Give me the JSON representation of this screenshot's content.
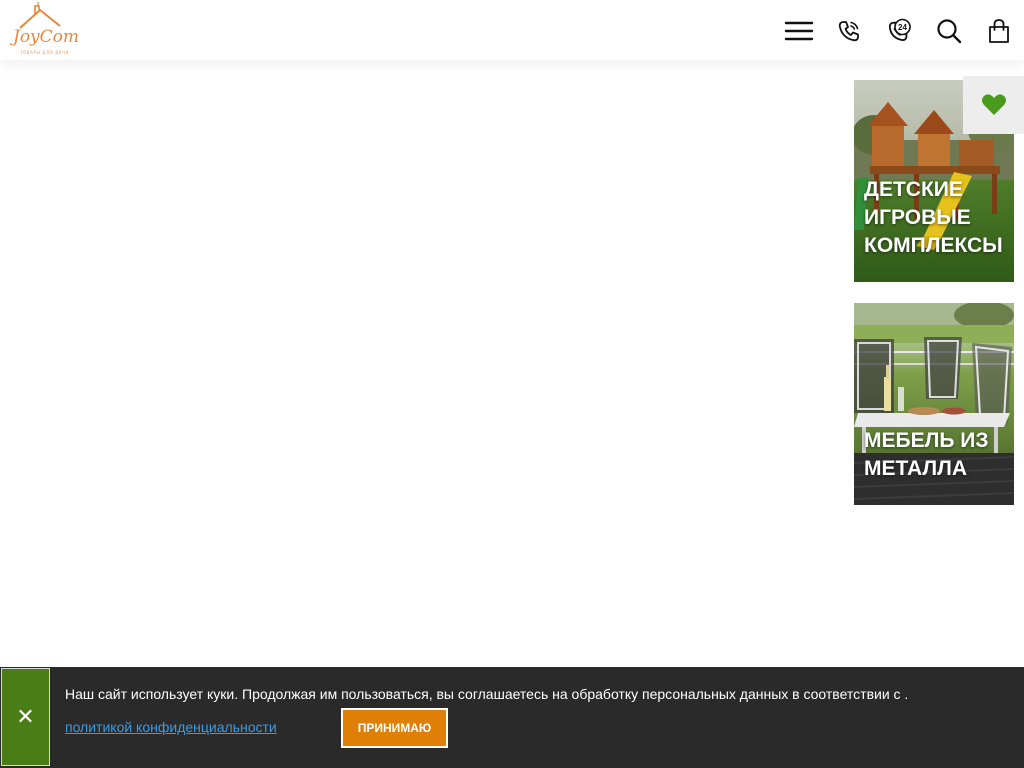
{
  "brand": {
    "logo_text": "JoyCom",
    "logo_subtitle": "ТОВАРЫ ДЛЯ ДАЧИ",
    "colors": {
      "logo": "#e8873a",
      "accent_green": "#4a7d16",
      "accent_orange": "#e07f05"
    }
  },
  "header": {
    "icons": [
      "menu-icon",
      "phone-icon",
      "phone-24-icon",
      "search-icon",
      "cart-icon"
    ],
    "callback_badge": "24"
  },
  "categories": [
    {
      "title": "Детские игровые комплексы"
    },
    {
      "title": "Мебель из металла"
    }
  ],
  "favorites": {
    "icon": "heart-icon",
    "color": "#4a9a1c"
  },
  "cookie": {
    "text": "Наш сайт использует куки. Продолжая им пользоваться, вы соглашаетесь на обработку персональных данных в соответствии с .",
    "link": "политикой конфиденциальности",
    "accept": "Принимаю",
    "close_icon": "close-icon"
  }
}
